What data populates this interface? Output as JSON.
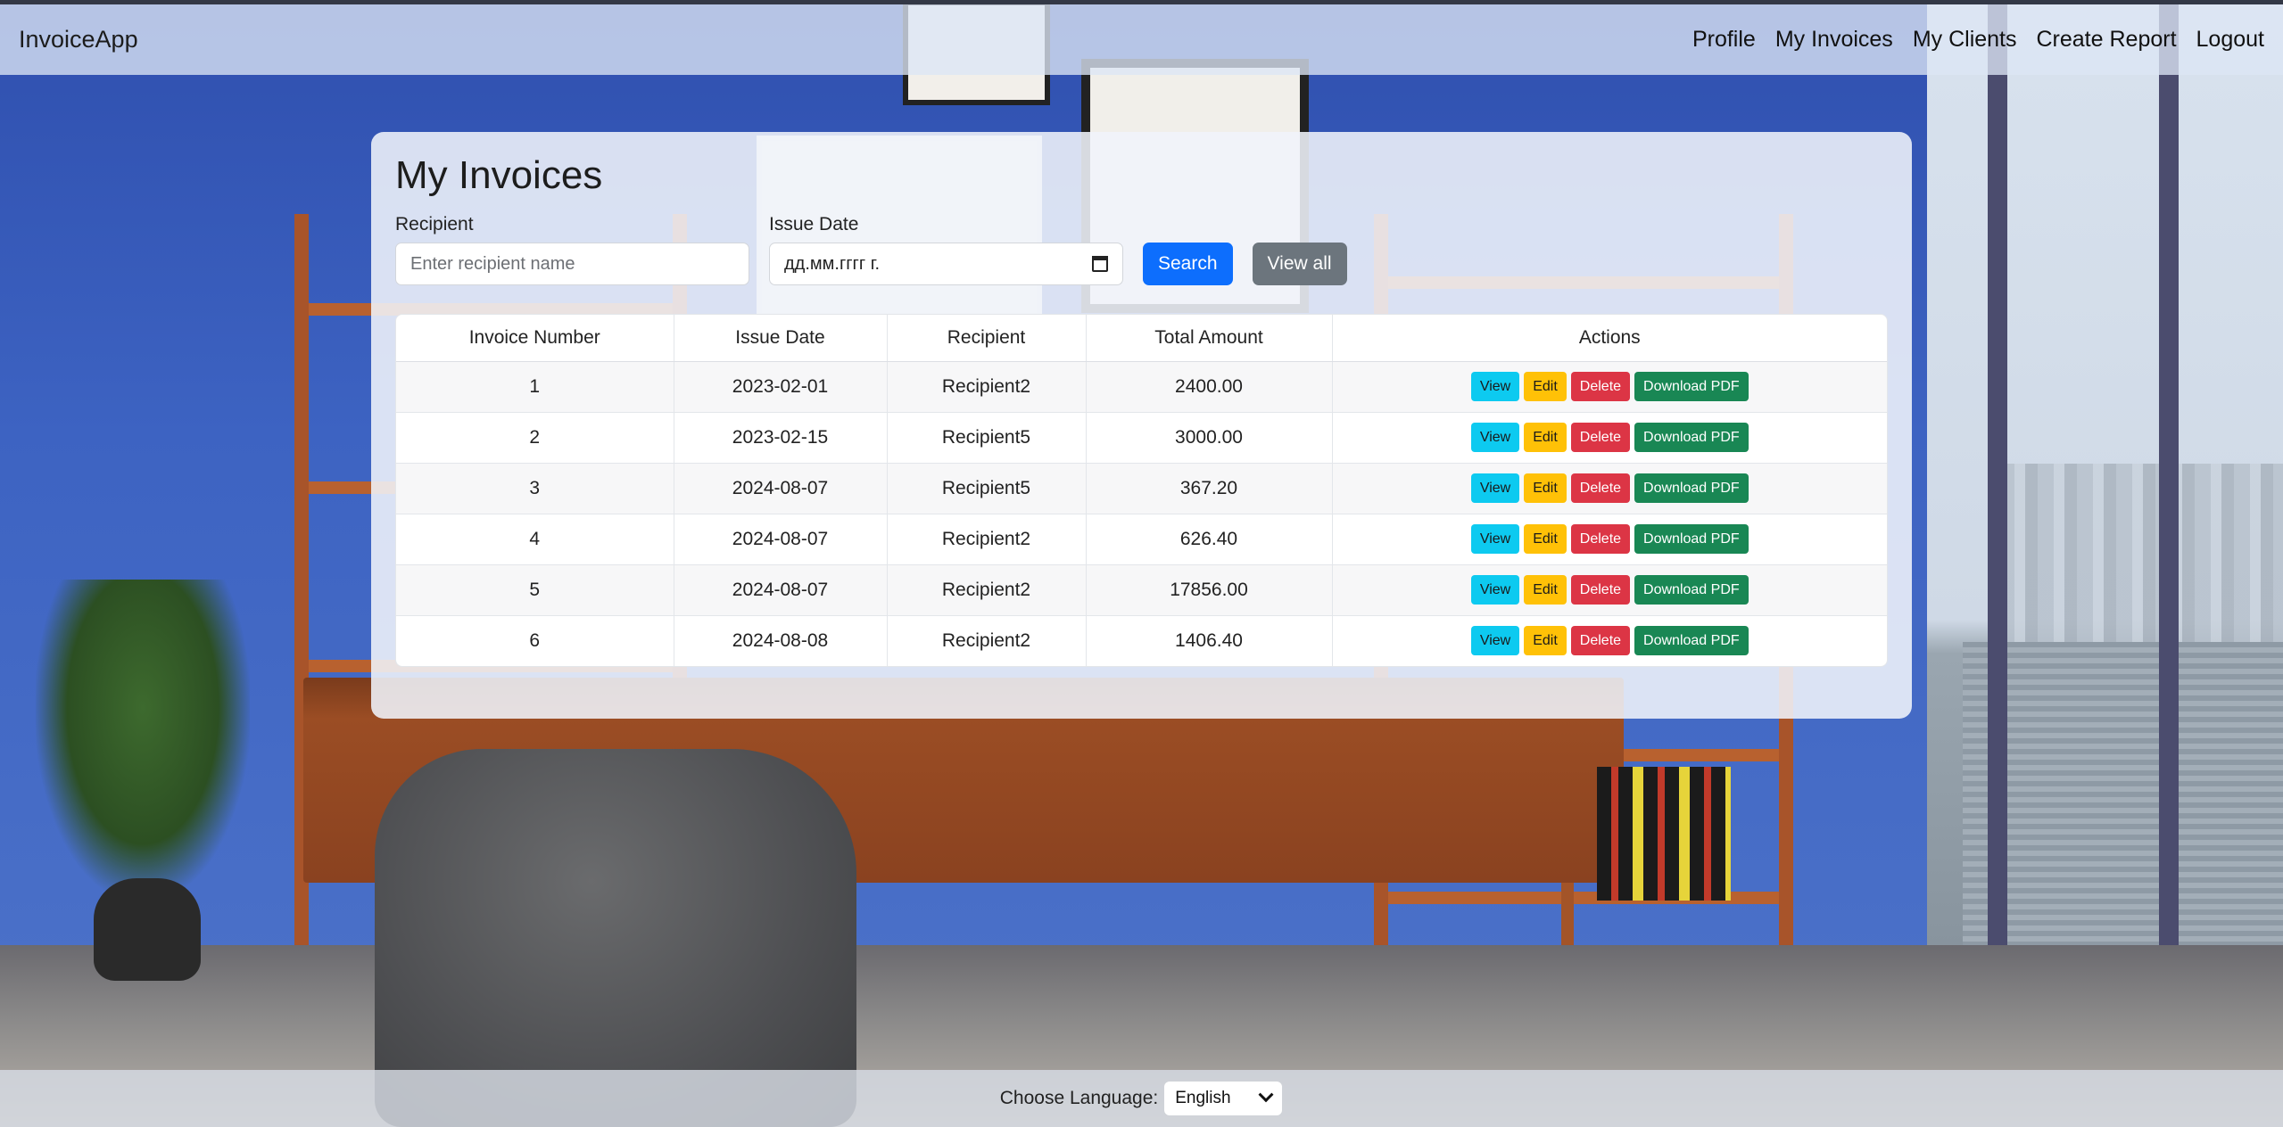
{
  "navbar": {
    "brand": "InvoiceApp",
    "links": [
      "Profile",
      "My Invoices",
      "My Clients",
      "Create Report",
      "Logout"
    ]
  },
  "main": {
    "title": "My Invoices",
    "recipient_label": "Recipient",
    "recipient_placeholder": "Enter recipient name",
    "recipient_value": "",
    "issue_date_label": "Issue Date",
    "issue_date_placeholder": "дд.мм.гггг г.",
    "search_label": "Search",
    "view_all_label": "View all"
  },
  "table": {
    "headers": [
      "Invoice Number",
      "Issue Date",
      "Recipient",
      "Total Amount",
      "Actions"
    ],
    "rows": [
      {
        "number": "1",
        "date": "2023-02-01",
        "recipient": "Recipient2",
        "amount": "2400.00"
      },
      {
        "number": "2",
        "date": "2023-02-15",
        "recipient": "Recipient5",
        "amount": "3000.00"
      },
      {
        "number": "3",
        "date": "2024-08-07",
        "recipient": "Recipient5",
        "amount": "367.20"
      },
      {
        "number": "4",
        "date": "2024-08-07",
        "recipient": "Recipient2",
        "amount": "626.40"
      },
      {
        "number": "5",
        "date": "2024-08-07",
        "recipient": "Recipient2",
        "amount": "17856.00"
      },
      {
        "number": "6",
        "date": "2024-08-08",
        "recipient": "Recipient2",
        "amount": "1406.40"
      }
    ],
    "actions": {
      "view": "View",
      "edit": "Edit",
      "delete": "Delete",
      "pdf": "Download PDF"
    }
  },
  "footer": {
    "label": "Choose Language:",
    "language": "English"
  },
  "colors": {
    "primary": "#0d6efd",
    "secondary": "#6c757d",
    "info": "#0dcaf0",
    "warning": "#ffc107",
    "danger": "#dc3545",
    "success": "#198754"
  },
  "icons": {
    "date_picker": "calendar-icon",
    "select": "chevron-down-icon"
  }
}
